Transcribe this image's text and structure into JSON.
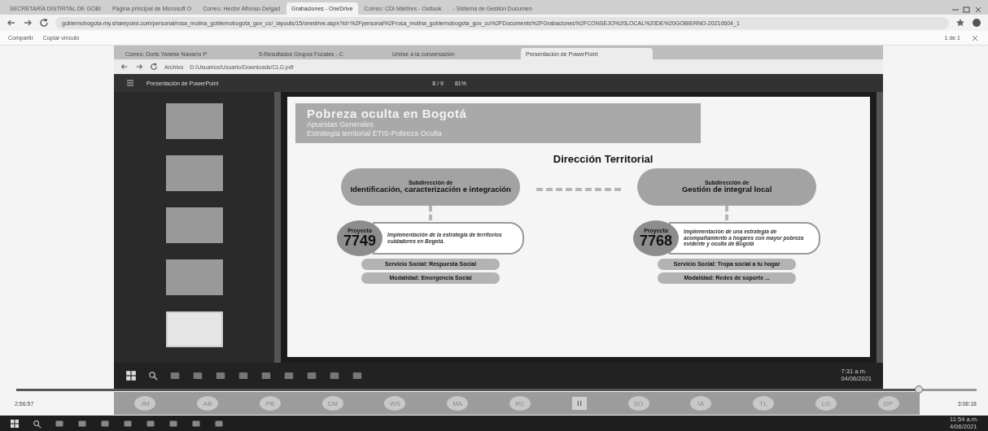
{
  "browser": {
    "tabs": [
      {
        "label": "SECRETARÍA DISTRITAL DE GOBI",
        "selected": false
      },
      {
        "label": "Página principal de Microsoft O",
        "selected": false
      },
      {
        "label": "Correo: Hector Alfonso Delgad",
        "selected": false
      },
      {
        "label": "Grabaciones - OneDrive",
        "selected": true
      },
      {
        "label": "Correo: CDI Mártires - Outlook",
        "selected": false
      },
      {
        "label": "- Sistema de Gestión Documen",
        "selected": false
      }
    ],
    "address": "gobiernobogota-my.sharepoint.com/personal/rosa_molina_gobiernobogota_gov_co/_layouts/15/onedrive.aspx?id=%2Fpersonal%2Frosa_molina_gobiernobogota_gov_co%2FDocuments%2FGrabaciones%2FCONSEJO%20LOCAL%20DE%20GOBIERNO-20210604_1",
    "share": "Compartir",
    "copy_link": "Copiar vínculo",
    "page_count": "1 de 1"
  },
  "recording": {
    "tabs": [
      {
        "label": "Correo: Doris Yaneke Navarro P",
        "selected": false
      },
      {
        "label": "5-Resultados Grupos Focales - C",
        "selected": false
      },
      {
        "label": "Unirse a la conversación",
        "selected": false
      },
      {
        "label": "Presentación de PowerPoint",
        "selected": true
      }
    ],
    "address_label": "Archivo",
    "address": "D:/Usuarios/Usuario/Downloads/CLG.pdf",
    "pdf_title": "Presentación de PowerPoint",
    "page": "8 / 9",
    "zoom": "81%",
    "thumbnails": [
      {
        "selected": false
      },
      {
        "selected": false
      },
      {
        "selected": false
      },
      {
        "selected": false
      },
      {
        "selected": true
      }
    ],
    "slide": {
      "title": "Pobreza oculta en Bogotá",
      "subtitles": [
        "Apuestas Generales",
        "Estrategia territorial ETIS-Pobreza Oculta"
      ],
      "heading": "Dirección Territorial",
      "branches": [
        {
          "prefix": "Subdirección de",
          "name": "Identificación, caracterización e integración",
          "project_label": "Proyecto",
          "project_number": "7749",
          "description": "Implementación de la estrategia de territorios cuidadores en Bogotá.",
          "service": "Servicio Social: Respuesta Social",
          "modality": "Modalidad: Emergencia Social"
        },
        {
          "prefix": "Subdirección de",
          "name": "Gestión de integral local",
          "project_label": "Proyecto",
          "project_number": "7768",
          "description": "Implementación de una estrategia de acompañamiento a hogares con mayor pobreza evidente y oculta de Bogotá",
          "service": "Servicio Social: Tropa social a tu hogar",
          "modality": "Modalidad: Redes de soporte ..."
        }
      ]
    },
    "clock": {
      "time": "7:31 a.m.",
      "date": "04/06/2021"
    }
  },
  "player": {
    "elapsed": "2:56:57",
    "duration": "3:08:18",
    "level": 0.94,
    "participants": [
      {
        "initials": "JM"
      },
      {
        "initials": "AB"
      },
      {
        "initials": "PB"
      },
      {
        "initials": "CM"
      },
      {
        "initials": "WS"
      },
      {
        "initials": "MA"
      },
      {
        "initials": "RC"
      },
      {
        "initials": "SO"
      },
      {
        "initials": "IA"
      },
      {
        "initials": "TL"
      },
      {
        "initials": "LG"
      },
      {
        "initials": "DP"
      }
    ]
  },
  "taskbar": {
    "time": "11:54 a.m.",
    "date": "4/06/2021"
  }
}
